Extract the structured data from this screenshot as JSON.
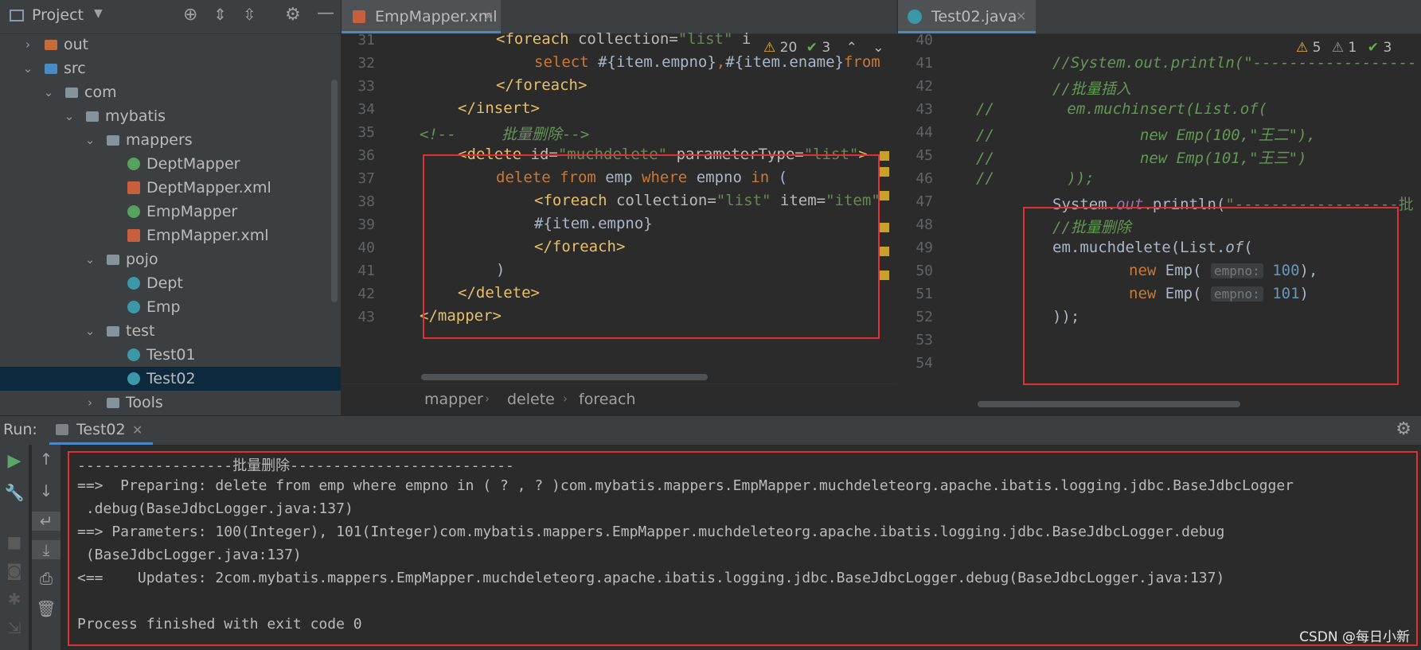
{
  "project_panel": {
    "title": "Project",
    "tree": [
      {
        "label": "out",
        "type": "folder-out",
        "depth": 1,
        "arrow": "›"
      },
      {
        "label": "src",
        "type": "folder-src",
        "depth": 1,
        "arrow": "⌄"
      },
      {
        "label": "com",
        "type": "folder",
        "depth": 2,
        "arrow": "⌄"
      },
      {
        "label": "mybatis",
        "type": "folder",
        "depth": 3,
        "arrow": "⌄"
      },
      {
        "label": "mappers",
        "type": "folder",
        "depth": 4,
        "arrow": "⌄"
      },
      {
        "label": "DeptMapper",
        "type": "interface",
        "depth": 5,
        "arrow": ""
      },
      {
        "label": "DeptMapper.xml",
        "type": "xml",
        "depth": 5,
        "arrow": ""
      },
      {
        "label": "EmpMapper",
        "type": "interface",
        "depth": 5,
        "arrow": ""
      },
      {
        "label": "EmpMapper.xml",
        "type": "xml",
        "depth": 5,
        "arrow": ""
      },
      {
        "label": "pojo",
        "type": "folder",
        "depth": 4,
        "arrow": "⌄"
      },
      {
        "label": "Dept",
        "type": "class",
        "depth": 5,
        "arrow": ""
      },
      {
        "label": "Emp",
        "type": "class",
        "depth": 5,
        "arrow": ""
      },
      {
        "label": "test",
        "type": "folder",
        "depth": 4,
        "arrow": "⌄"
      },
      {
        "label": "Test01",
        "type": "testclass",
        "depth": 5,
        "arrow": ""
      },
      {
        "label": "Test02",
        "type": "testclass",
        "depth": 5,
        "arrow": "",
        "selected": true
      },
      {
        "label": "Tools",
        "type": "folder",
        "depth": 4,
        "arrow": "›"
      }
    ]
  },
  "editor_left": {
    "tab_label": "EmpMapper.xml",
    "inspections": {
      "warnings": "20",
      "ok": "3"
    },
    "line_numbers": [
      "31",
      "32",
      "33",
      "34",
      "35",
      "36",
      "37",
      "38",
      "39",
      "40",
      "41",
      "42",
      "43"
    ],
    "breadcrumb": [
      "mapper",
      "delete",
      "foreach"
    ]
  },
  "editor_right": {
    "tab_label": "Test02.java",
    "inspections": {
      "warnings": "5",
      "weak": "1",
      "ok": "3"
    },
    "line_numbers": [
      "40",
      "41",
      "42",
      "43",
      "44",
      "45",
      "46",
      "47",
      "48",
      "49",
      "50",
      "51",
      "52",
      "53",
      "54"
    ]
  },
  "run_panel": {
    "label": "Run:",
    "tab_label": "Test02",
    "console": [
      "------------------批量删除--------------------------",
      "==>  Preparing: delete from emp where empno in ( ? , ? )com.mybatis.mappers.EmpMapper.muchdeleteorg.apache.ibatis.logging.jdbc.BaseJdbcLogger",
      " .debug(BaseJdbcLogger.java:137)",
      "==> Parameters: 100(Integer), 101(Integer)com.mybatis.mappers.EmpMapper.muchdeleteorg.apache.ibatis.logging.jdbc.BaseJdbcLogger.debug",
      " (BaseJdbcLogger.java:137)",
      "<==    Updates: 2com.mybatis.mappers.EmpMapper.muchdeleteorg.apache.ibatis.logging.jdbc.BaseJdbcLogger.debug(BaseJdbcLogger.java:137)",
      "",
      "Process finished with exit code 0"
    ]
  },
  "watermark": "CSDN @每日小新",
  "colors": {
    "highlight_box": "#e03030",
    "selection": "#0d293e",
    "accent": "#4a88c7"
  }
}
